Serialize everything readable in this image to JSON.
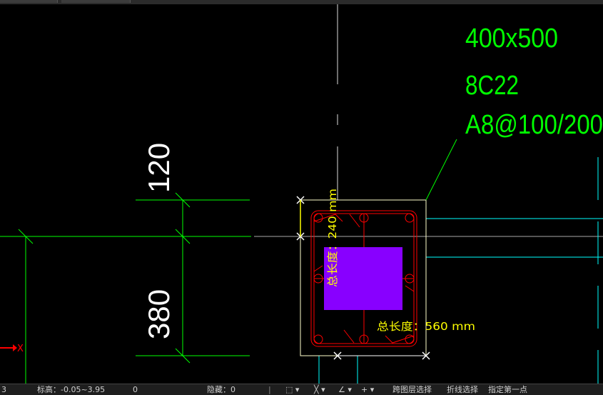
{
  "colors": {
    "background": "#000000",
    "dim_green": "#00ff00",
    "axis_cyan": "#00ffff",
    "rebar_red": "#ff0000",
    "label_yellow": "#ffff00",
    "column_white": "#ffffff",
    "highlight_purple": "#8800ff"
  },
  "annotation": {
    "size": "400x500",
    "main_rebar": "8C22",
    "stirrup": "A8@100/200"
  },
  "dimensions": {
    "top": "120",
    "bottom": "380"
  },
  "measure": {
    "vertical_label": "总长度：240 mm",
    "horizontal_label": "总长度：560 mm"
  },
  "ucs": {
    "x_label": "X"
  },
  "statusbar": {
    "layer_prefix": "3",
    "elevation": "标高：-0.05~3.95",
    "count": "0",
    "hidden": "隐藏：0",
    "cross_layer_select": "跨图层选择",
    "polyline_select": "折线选择",
    "snap_point": "指定第一点"
  }
}
